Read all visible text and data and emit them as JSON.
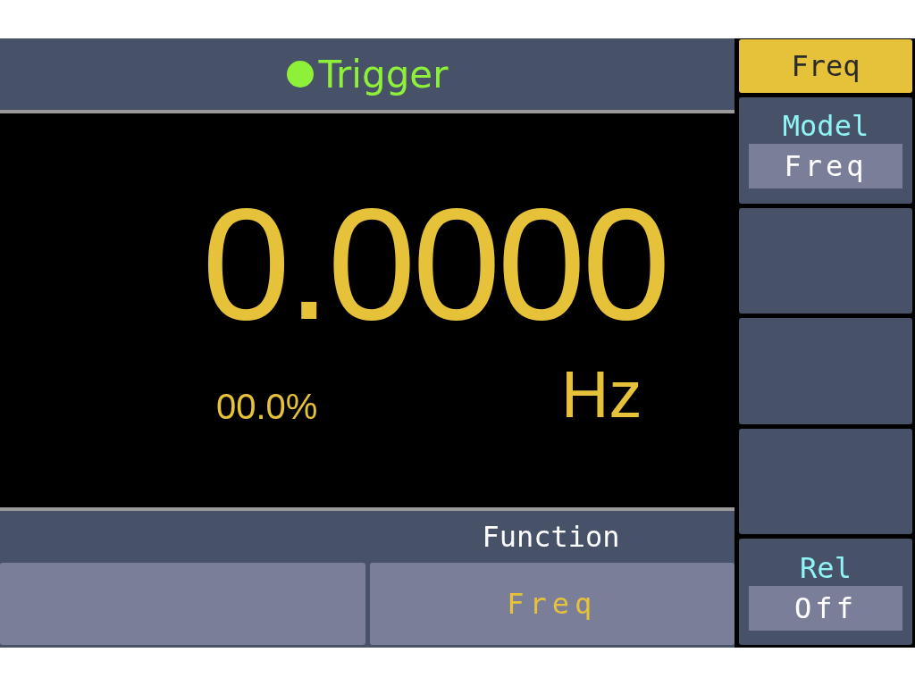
{
  "header": {
    "title": "Trigger",
    "active": true
  },
  "display": {
    "reading": "0.0000",
    "unit": "Hz",
    "percent": "00.0%"
  },
  "function_bar": {
    "label": "Function",
    "slots": [
      {
        "kind": "blank"
      },
      {
        "kind": "value",
        "value": "Freq"
      }
    ]
  },
  "softkeys": [
    {
      "kind": "title",
      "label": "Freq"
    },
    {
      "kind": "option",
      "label": "Model",
      "value": "Freq"
    },
    {
      "kind": "blank"
    },
    {
      "kind": "blank"
    },
    {
      "kind": "blank"
    },
    {
      "kind": "option",
      "label": "Rel",
      "value": "Off"
    }
  ]
}
